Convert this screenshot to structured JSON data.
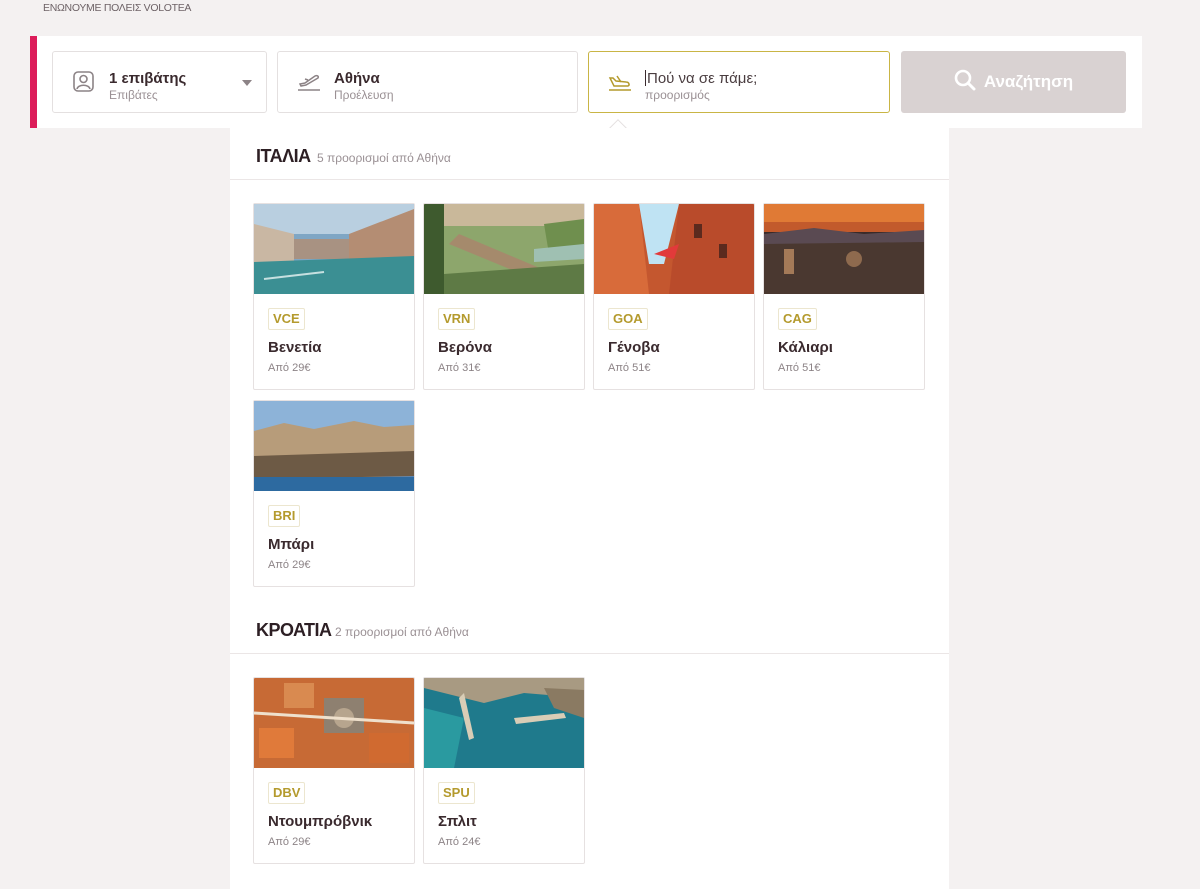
{
  "top_caption": "ΕΝΩΝΟΥΜΕ ΠΟΛΕΙΣ VOLOTEA",
  "search": {
    "passengers_value": "1 επιβάτης",
    "passengers_label": "Επιβάτες",
    "origin_value": "Αθήνα",
    "origin_label": "Προέλευση",
    "destination_placeholder": "Πού να σε πάμε;",
    "destination_label": "προορισμός",
    "search_button": "Αναζήτηση"
  },
  "countries": [
    {
      "name": "ΙΤΑΛΙΑ",
      "count": "5 προορισμοί από Αθήνα",
      "destinations": [
        {
          "code": "VCE",
          "city": "Βενετία",
          "price": "Από 29€"
        },
        {
          "code": "VRN",
          "city": "Βερόνα",
          "price": "Από 31€"
        },
        {
          "code": "GOA",
          "city": "Γένοβα",
          "price": "Από 51€"
        },
        {
          "code": "CAG",
          "city": "Κάλιαρι",
          "price": "Από 51€"
        },
        {
          "code": "BRI",
          "city": "Μπάρι",
          "price": "Από 29€"
        }
      ]
    },
    {
      "name": "ΚΡΟΑΤΙΑ",
      "count": "2 προορισμοί από Αθήνα",
      "destinations": [
        {
          "code": "DBV",
          "city": "Ντουμπρόβνικ",
          "price": "Από 29€"
        },
        {
          "code": "SPU",
          "city": "Σπλιτ",
          "price": "Από 24€"
        }
      ]
    }
  ],
  "colors": {
    "accent_bar": "#dc1d5a",
    "code_text": "#b49a2d",
    "focus_border": "#c9b545",
    "search_button_bg": "#d9d2d2"
  },
  "icons": {
    "passengers": "passenger-icon",
    "origin": "takeoff-icon",
    "destination": "landing-icon",
    "search": "search-icon"
  }
}
